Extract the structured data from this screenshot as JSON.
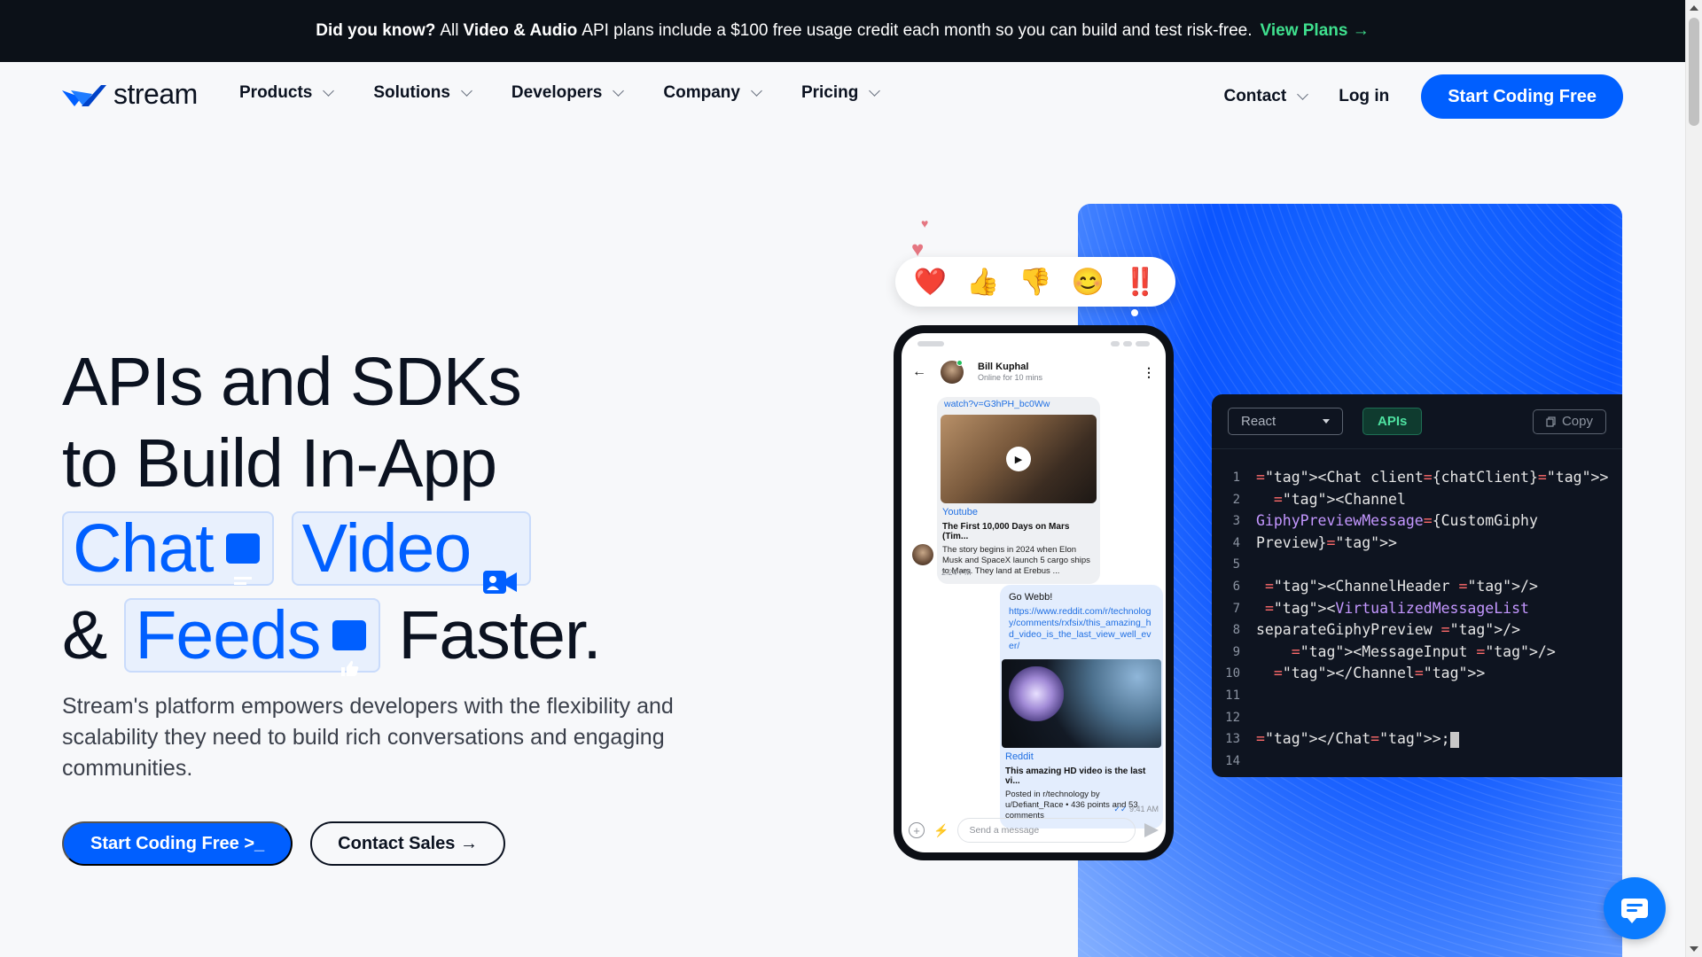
{
  "banner": {
    "lead": "Did you know?",
    "pre": "All",
    "product": "Video & Audio",
    "rest": "API plans include a $100 free usage credit each month so you can build and test risk-free.",
    "link": "View Plans →"
  },
  "nav": {
    "logo_text": "stream",
    "items": [
      "Products",
      "Solutions",
      "Developers",
      "Company",
      "Pricing"
    ],
    "contact": "Contact",
    "login": "Log in",
    "cta": "Start Coding Free"
  },
  "hero": {
    "line1": "APIs and SDKs",
    "line2": "to Build In-App",
    "chat": "Chat",
    "video": "Video",
    "amp": "&",
    "feeds": "Feeds",
    "faster": "Faster.",
    "desc": "Stream's platform empowers developers with the flexibility and scalability they need to build rich conversations and engaging communities.",
    "btn_primary": "Start Coding Free >_",
    "btn_secondary": "Contact Sales →"
  },
  "reactions": [
    "❤️",
    "👍",
    "👎",
    "😊",
    "‼️"
  ],
  "phone": {
    "user_name": "Bill Kuphal",
    "user_status": "Online for 10 mins",
    "msg1_url": "watch?v=G3hPH_bc0Ww",
    "msg1_source": "Youtube",
    "msg1_title": "The First 10,000 Days on Mars (Tim...",
    "msg1_desc": "The story begins in 2024 when Elon Musk and SpaceX launch 5 cargo ships to Mars. They land at Erebus ...",
    "msg1_time": "2:24 PM",
    "msg2_text": "Go Webb!",
    "msg2_url": "https://www.reddit.com/r/technology/comments/rxfsix/this_amazing_hd_video_is_the_last_view_well_ever/",
    "msg2_source": "Reddit",
    "msg2_title": "This amazing HD video is the last vi...",
    "msg2_desc": "Posted in r/technology by u/Defiant_Race • 436 points and 53 comments",
    "msg2_time": "9:41 AM",
    "input_placeholder": "Send a message"
  },
  "code": {
    "framework": "React",
    "tab": "APIs",
    "copy": "Copy",
    "lines": [
      "<Chat client={chatClient}>",
      "  <Channel",
      "GiphyPreviewMessage={CustomGiphy",
      "Preview}>",
      "",
      " <ChannelHeader />",
      " <VirtualizedMessageList",
      "separateGiphyPreview />",
      "    <MessageInput />",
      "  </Channel>",
      "",
      "",
      "</Chat>;",
      ""
    ]
  },
  "colors": {
    "brand_blue": "#005fff",
    "banner_bg": "#0c1118",
    "banner_link": "#3fe08e",
    "code_bg": "#0e1420"
  }
}
